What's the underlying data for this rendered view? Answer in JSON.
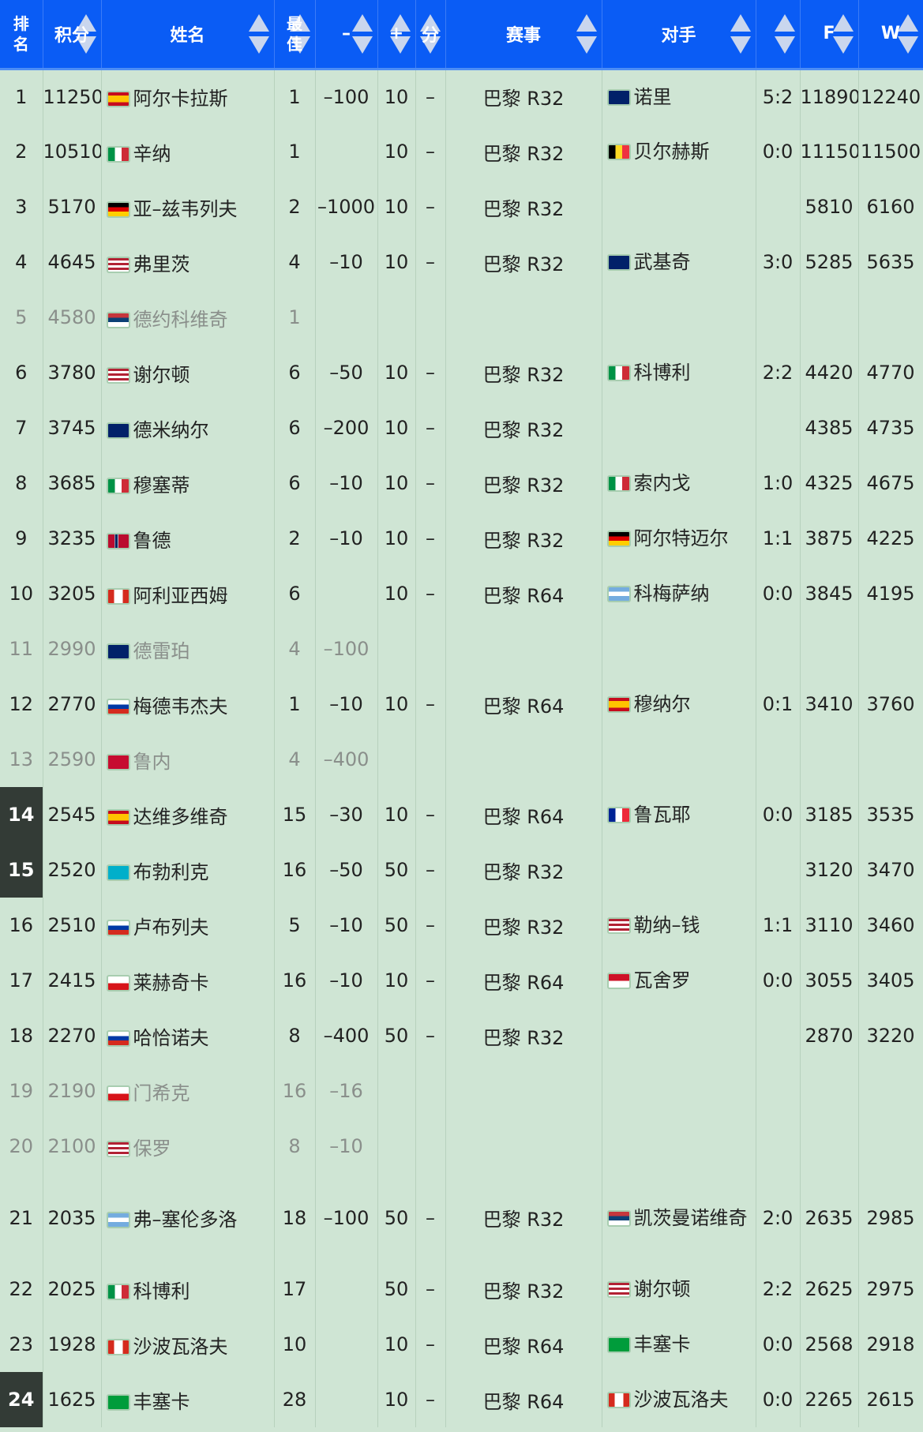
{
  "headers": [
    "排名",
    "积分",
    "姓名",
    "最佳",
    "–",
    "+",
    "分",
    "赛事",
    "对手",
    "",
    "F",
    "W"
  ],
  "flags": {
    "ESP": "linear-gradient(#c60b1e 25%,#ffc400 25%,#ffc400 75%,#c60b1e 75%)",
    "ITA": "linear-gradient(90deg,#009246 33%,#fff 33%,#fff 66%,#ce2b37 66%)",
    "GER": "linear-gradient(#000 33%,#dd0000 33%,#dd0000 66%,#ffce00 66%)",
    "USA": "repeating-linear-gradient(#b22234 0 3px,#fff 3px 6px)",
    "SRB": "linear-gradient(#c6363c 33%,#0c4076 33%,#0c4076 66%,#fff 66%)",
    "AUS": "#012169",
    "NOR": "linear-gradient(90deg,transparent 30%,#fff 30%,#00205b 36%,#00205b 44%,#fff 50%,transparent 50%),#ba0c2f",
    "CAN": "linear-gradient(90deg,#d52b1e 28%,#fff 28%,#fff 72%,#d52b1e 72%)",
    "GBR": "#012169",
    "RUS": "linear-gradient(#fff 33%,#0039a6 33%,#0039a6 66%,#d52b1e 66%)",
    "DEN": "#c60c30",
    "KAZ": "#00afca",
    "CZE": "linear-gradient(#fff 50%,#d7141a 50%)",
    "ARG": "linear-gradient(#74acdf 33%,#fff 33%,#fff 66%,#74acdf 66%)",
    "BRA": "#009c3b",
    "BEL": "linear-gradient(90deg,#000 33%,#fdda24 33%,#fdda24 66%,#ef3340 66%)",
    "FRA": "linear-gradient(90deg,#002395 33%,#fff 33%,#fff 66%,#ed2939 66%)",
    "INA": "linear-gradient(#ce1126 50%,#fff 50%)"
  },
  "rows": [
    {
      "rank": "1",
      "pts": "11250",
      "flag": "ESP",
      "name": "阿尔卡拉斯",
      "best": "1",
      "minus": "–100",
      "plus": "10",
      "fen": "–",
      "event": "巴黎 R32",
      "oflag": "GBR",
      "opp": "诺里",
      "score": "5:2",
      "f": "11890",
      "w": "12240"
    },
    {
      "rank": "2",
      "pts": "10510",
      "flag": "ITA",
      "name": "辛纳",
      "best": "1",
      "minus": "",
      "plus": "10",
      "fen": "–",
      "event": "巴黎 R32",
      "oflag": "BEL",
      "opp": "贝尔赫斯",
      "score": "0:0",
      "f": "11150",
      "w": "11500"
    },
    {
      "rank": "3",
      "pts": "5170",
      "flag": "GER",
      "name": "亚–兹韦列夫",
      "best": "2",
      "minus": "–1000",
      "plus": "10",
      "fen": "–",
      "event": "巴黎 R32",
      "oflag": "",
      "opp": "",
      "score": "",
      "f": "5810",
      "w": "6160"
    },
    {
      "rank": "4",
      "pts": "4645",
      "flag": "USA",
      "name": "弗里茨",
      "best": "4",
      "minus": "–10",
      "plus": "10",
      "fen": "–",
      "event": "巴黎 R32",
      "oflag": "AUS",
      "opp": "武基奇",
      "score": "3:0",
      "f": "5285",
      "w": "5635"
    },
    {
      "rank": "5",
      "pts": "4580",
      "flag": "SRB",
      "name": "德约科维奇",
      "best": "1",
      "minus": "",
      "plus": "",
      "fen": "",
      "event": "",
      "oflag": "",
      "opp": "",
      "score": "",
      "f": "",
      "w": "",
      "dim": true
    },
    {
      "rank": "6",
      "pts": "3780",
      "flag": "USA",
      "name": "谢尔顿",
      "best": "6",
      "minus": "–50",
      "plus": "10",
      "fen": "–",
      "event": "巴黎 R32",
      "oflag": "ITA",
      "opp": "科博利",
      "score": "2:2",
      "f": "4420",
      "w": "4770"
    },
    {
      "rank": "7",
      "pts": "3745",
      "flag": "AUS",
      "name": "德米纳尔",
      "best": "6",
      "minus": "–200",
      "plus": "10",
      "fen": "–",
      "event": "巴黎 R32",
      "oflag": "",
      "opp": "",
      "score": "",
      "f": "4385",
      "w": "4735"
    },
    {
      "rank": "8",
      "pts": "3685",
      "flag": "ITA",
      "name": "穆塞蒂",
      "best": "6",
      "minus": "–10",
      "plus": "10",
      "fen": "–",
      "event": "巴黎 R32",
      "oflag": "ITA",
      "opp": "索内戈",
      "score": "1:0",
      "f": "4325",
      "w": "4675"
    },
    {
      "rank": "9",
      "pts": "3235",
      "flag": "NOR",
      "name": "鲁德",
      "best": "2",
      "minus": "–10",
      "plus": "10",
      "fen": "–",
      "event": "巴黎 R32",
      "oflag": "GER",
      "opp": "阿尔特迈尔",
      "score": "1:1",
      "f": "3875",
      "w": "4225"
    },
    {
      "rank": "10",
      "pts": "3205",
      "flag": "CAN",
      "name": "阿利亚西姆",
      "best": "6",
      "minus": "",
      "plus": "10",
      "fen": "–",
      "event": "巴黎 R64",
      "oflag": "ARG",
      "opp": "科梅萨纳",
      "score": "0:0",
      "f": "3845",
      "w": "4195"
    },
    {
      "rank": "11",
      "pts": "2990",
      "flag": "GBR",
      "name": "德雷珀",
      "best": "4",
      "minus": "–100",
      "plus": "",
      "fen": "",
      "event": "",
      "oflag": "",
      "opp": "",
      "score": "",
      "f": "",
      "w": "",
      "dim": true
    },
    {
      "rank": "12",
      "pts": "2770",
      "flag": "RUS",
      "name": "梅德韦杰夫",
      "best": "1",
      "minus": "–10",
      "plus": "10",
      "fen": "–",
      "event": "巴黎 R64",
      "oflag": "ESP",
      "opp": "穆纳尔",
      "score": "0:1",
      "f": "3410",
      "w": "3760"
    },
    {
      "rank": "13",
      "pts": "2590",
      "flag": "DEN",
      "name": "鲁内",
      "best": "4",
      "minus": "–400",
      "plus": "",
      "fen": "",
      "event": "",
      "oflag": "",
      "opp": "",
      "score": "",
      "f": "",
      "w": "",
      "dim": true
    },
    {
      "rank": "14",
      "pts": "2545",
      "flag": "ESP",
      "name": "达维多维奇",
      "best": "15",
      "minus": "–30",
      "plus": "10",
      "fen": "–",
      "event": "巴黎 R64",
      "oflag": "FRA",
      "opp": "鲁瓦耶",
      "score": "0:0",
      "f": "3185",
      "w": "3535",
      "hl": true
    },
    {
      "rank": "15",
      "pts": "2520",
      "flag": "KAZ",
      "name": "布勃利克",
      "best": "16",
      "minus": "–50",
      "plus": "50",
      "fen": "–",
      "event": "巴黎 R32",
      "oflag": "",
      "opp": "",
      "score": "",
      "f": "3120",
      "w": "3470",
      "hl": true
    },
    {
      "rank": "16",
      "pts": "2510",
      "flag": "RUS",
      "name": "卢布列夫",
      "best": "5",
      "minus": "–10",
      "plus": "50",
      "fen": "–",
      "event": "巴黎 R32",
      "oflag": "USA",
      "opp": "勒纳–钱",
      "score": "1:1",
      "f": "3110",
      "w": "3460"
    },
    {
      "rank": "17",
      "pts": "2415",
      "flag": "CZE",
      "name": "莱赫奇卡",
      "best": "16",
      "minus": "–10",
      "plus": "10",
      "fen": "–",
      "event": "巴黎 R64",
      "oflag": "INA",
      "opp": "瓦舍罗",
      "score": "0:0",
      "f": "3055",
      "w": "3405"
    },
    {
      "rank": "18",
      "pts": "2270",
      "flag": "RUS",
      "name": "哈恰诺夫",
      "best": "8",
      "minus": "–400",
      "plus": "50",
      "fen": "–",
      "event": "巴黎 R32",
      "oflag": "",
      "opp": "",
      "score": "",
      "f": "2870",
      "w": "3220"
    },
    {
      "rank": "19",
      "pts": "2190",
      "flag": "CZE",
      "name": "门希克",
      "best": "16",
      "minus": "–16",
      "plus": "",
      "fen": "",
      "event": "",
      "oflag": "",
      "opp": "",
      "score": "",
      "f": "",
      "w": "",
      "dim": true
    },
    {
      "rank": "20",
      "pts": "2100",
      "flag": "USA",
      "name": "保罗",
      "best": "8",
      "minus": "–10",
      "plus": "",
      "fen": "",
      "event": "",
      "oflag": "",
      "opp": "",
      "score": "",
      "f": "",
      "w": "",
      "dim": true
    },
    {
      "rank": "21",
      "pts": "2035",
      "flag": "ARG",
      "name": "弗–塞伦多洛",
      "best": "18",
      "minus": "–100",
      "plus": "50",
      "fen": "–",
      "event": "巴黎 R32",
      "oflag": "SRB",
      "opp": "凯茨曼诺维奇",
      "score": "2:0",
      "f": "2635",
      "w": "2985",
      "tall": true
    },
    {
      "rank": "22",
      "pts": "2025",
      "flag": "ITA",
      "name": "科博利",
      "best": "17",
      "minus": "",
      "plus": "50",
      "fen": "–",
      "event": "巴黎 R32",
      "oflag": "USA",
      "opp": "谢尔顿",
      "score": "2:2",
      "f": "2625",
      "w": "2975"
    },
    {
      "rank": "23",
      "pts": "1928",
      "flag": "CAN",
      "name": "沙波瓦洛夫",
      "best": "10",
      "minus": "",
      "plus": "10",
      "fen": "–",
      "event": "巴黎 R64",
      "oflag": "BRA",
      "opp": "丰塞卡",
      "score": "0:0",
      "f": "2568",
      "w": "2918"
    },
    {
      "rank": "24",
      "pts": "1625",
      "flag": "BRA",
      "name": "丰塞卡",
      "best": "28",
      "minus": "",
      "plus": "10",
      "fen": "–",
      "event": "巴黎 R64",
      "oflag": "CAN",
      "opp": "沙波瓦洛夫",
      "score": "0:0",
      "f": "2265",
      "w": "2615",
      "hl": true
    }
  ]
}
